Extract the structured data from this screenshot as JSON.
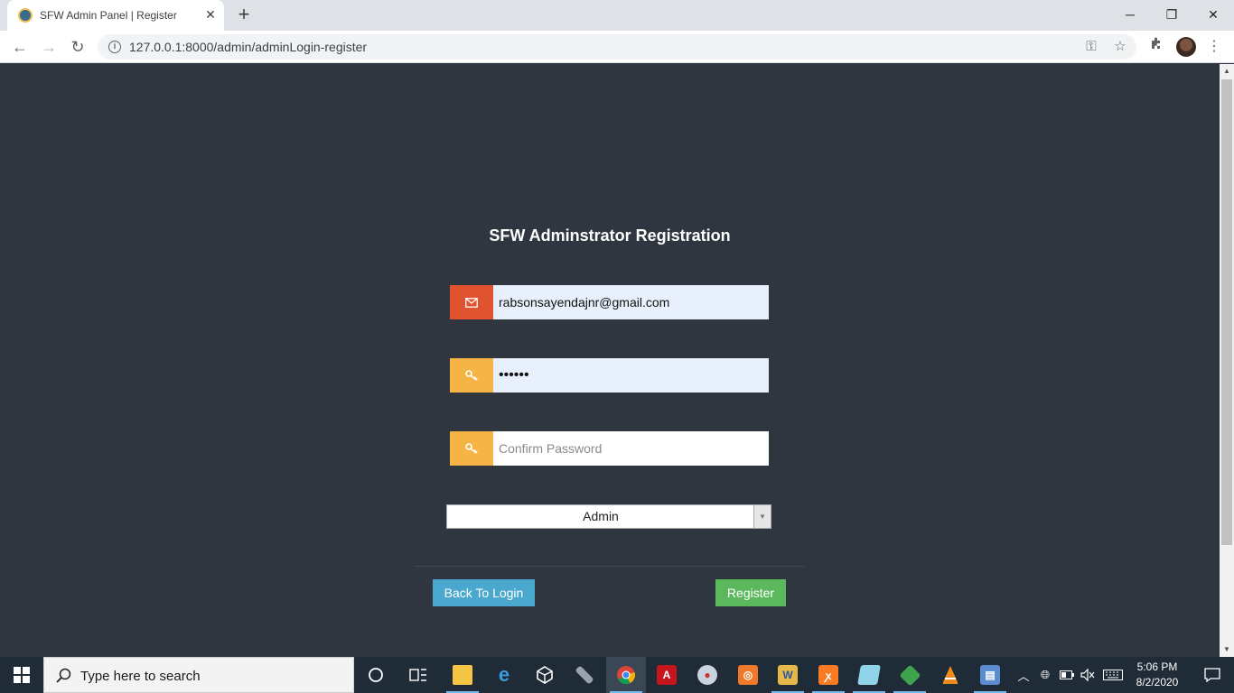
{
  "browser": {
    "tab_title": "SFW Admin Panel | Register",
    "tab_close": "✕",
    "new_tab": "+",
    "url": "127.0.0.1:8000/admin/adminLogin-register",
    "window_controls": {
      "minimize": "─",
      "maximize": "❐",
      "close": "✕"
    },
    "nav": {
      "back": "←",
      "forward": "→",
      "reload": "↻"
    }
  },
  "page": {
    "title": "SFW Adminstrator Registration",
    "email": {
      "value": "rabsonsayendajnr@gmail.com",
      "icon": "envelope-icon",
      "icon_color": "#e1532e"
    },
    "password": {
      "masked_value": "••••••",
      "icon": "key-icon",
      "icon_color": "#f7b446"
    },
    "confirm_password": {
      "placeholder": "Confirm Password",
      "icon": "key-icon",
      "icon_color": "#f7b446"
    },
    "role": {
      "selected": "Admin"
    },
    "back_button": "Back To Login",
    "register_button": "Register"
  },
  "taskbar": {
    "search_placeholder": "Type here to search",
    "time": "5:06 PM",
    "date": "8/2/2020"
  },
  "colors": {
    "page_background": "#2f3640",
    "input_filled": "#e8f0fe",
    "back_button": "#4aa8cf",
    "register_button": "#5cb85c"
  }
}
